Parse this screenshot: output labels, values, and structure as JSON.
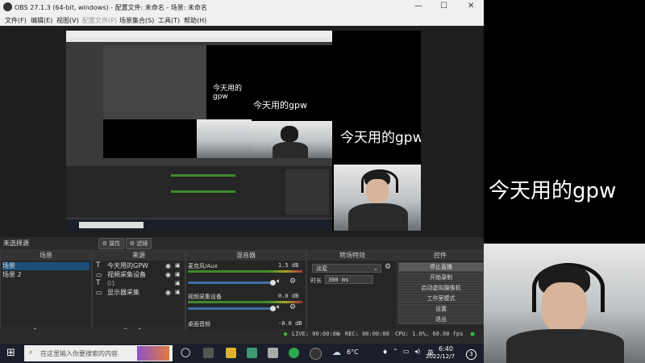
{
  "window": {
    "title": "OBS 27.1.3 (64-bit, windows) - 配置文件: 未命名 - 场景: 未命名",
    "controls": {
      "minimize": "—",
      "maximize": "☐",
      "close": "✕"
    }
  },
  "menu": [
    "文件(F)",
    "编辑(E)",
    "视图(V)",
    "配置文件(P)",
    "场景集合(S)",
    "工具(T)",
    "帮助(H)"
  ],
  "overlay_text": "今天用的gpw",
  "status_row": {
    "no_source": "未选择源",
    "properties": "属性",
    "filters": "滤镜"
  },
  "scenes": {
    "header": "场景",
    "items": [
      "场景",
      "场景 2"
    ]
  },
  "sources": {
    "header": "来源",
    "items": [
      "今天用的GPW",
      "视频采集设备",
      "01",
      "显示器采集"
    ]
  },
  "mixer": {
    "header": "混音器",
    "channels": [
      {
        "name": "麦克风/Aux",
        "db": "1.5 dB"
      },
      {
        "name": "视频采集设备",
        "db": "0.0 dB"
      },
      {
        "name": "桌面音频",
        "db": "-0.0 dB"
      }
    ]
  },
  "transitions": {
    "header": "转场特效",
    "type": "淡変",
    "duration_label": "时长",
    "duration": "300 ms"
  },
  "controls": {
    "header": "控件",
    "buttons": [
      "停止直播",
      "开始录制",
      "启动虚拟摄像机",
      "工作室模式",
      "设置",
      "退出"
    ]
  },
  "obs_status": {
    "live": "LIVE: 00:00:00",
    "rec": "REC: 00:00:00",
    "cpu": "CPU: 1.0%, 60.00 fps"
  },
  "taskbar": {
    "search_placeholder": "在这里输入你要搜索的内容",
    "weather": "6°C",
    "ime": "英",
    "time": "6:40",
    "date": "2022/12/7",
    "notifications": "3"
  },
  "colors": {
    "accent": "#1d4f7a",
    "taskbar": "#1a1f2a",
    "obs_bg": "#2b2b2b"
  }
}
